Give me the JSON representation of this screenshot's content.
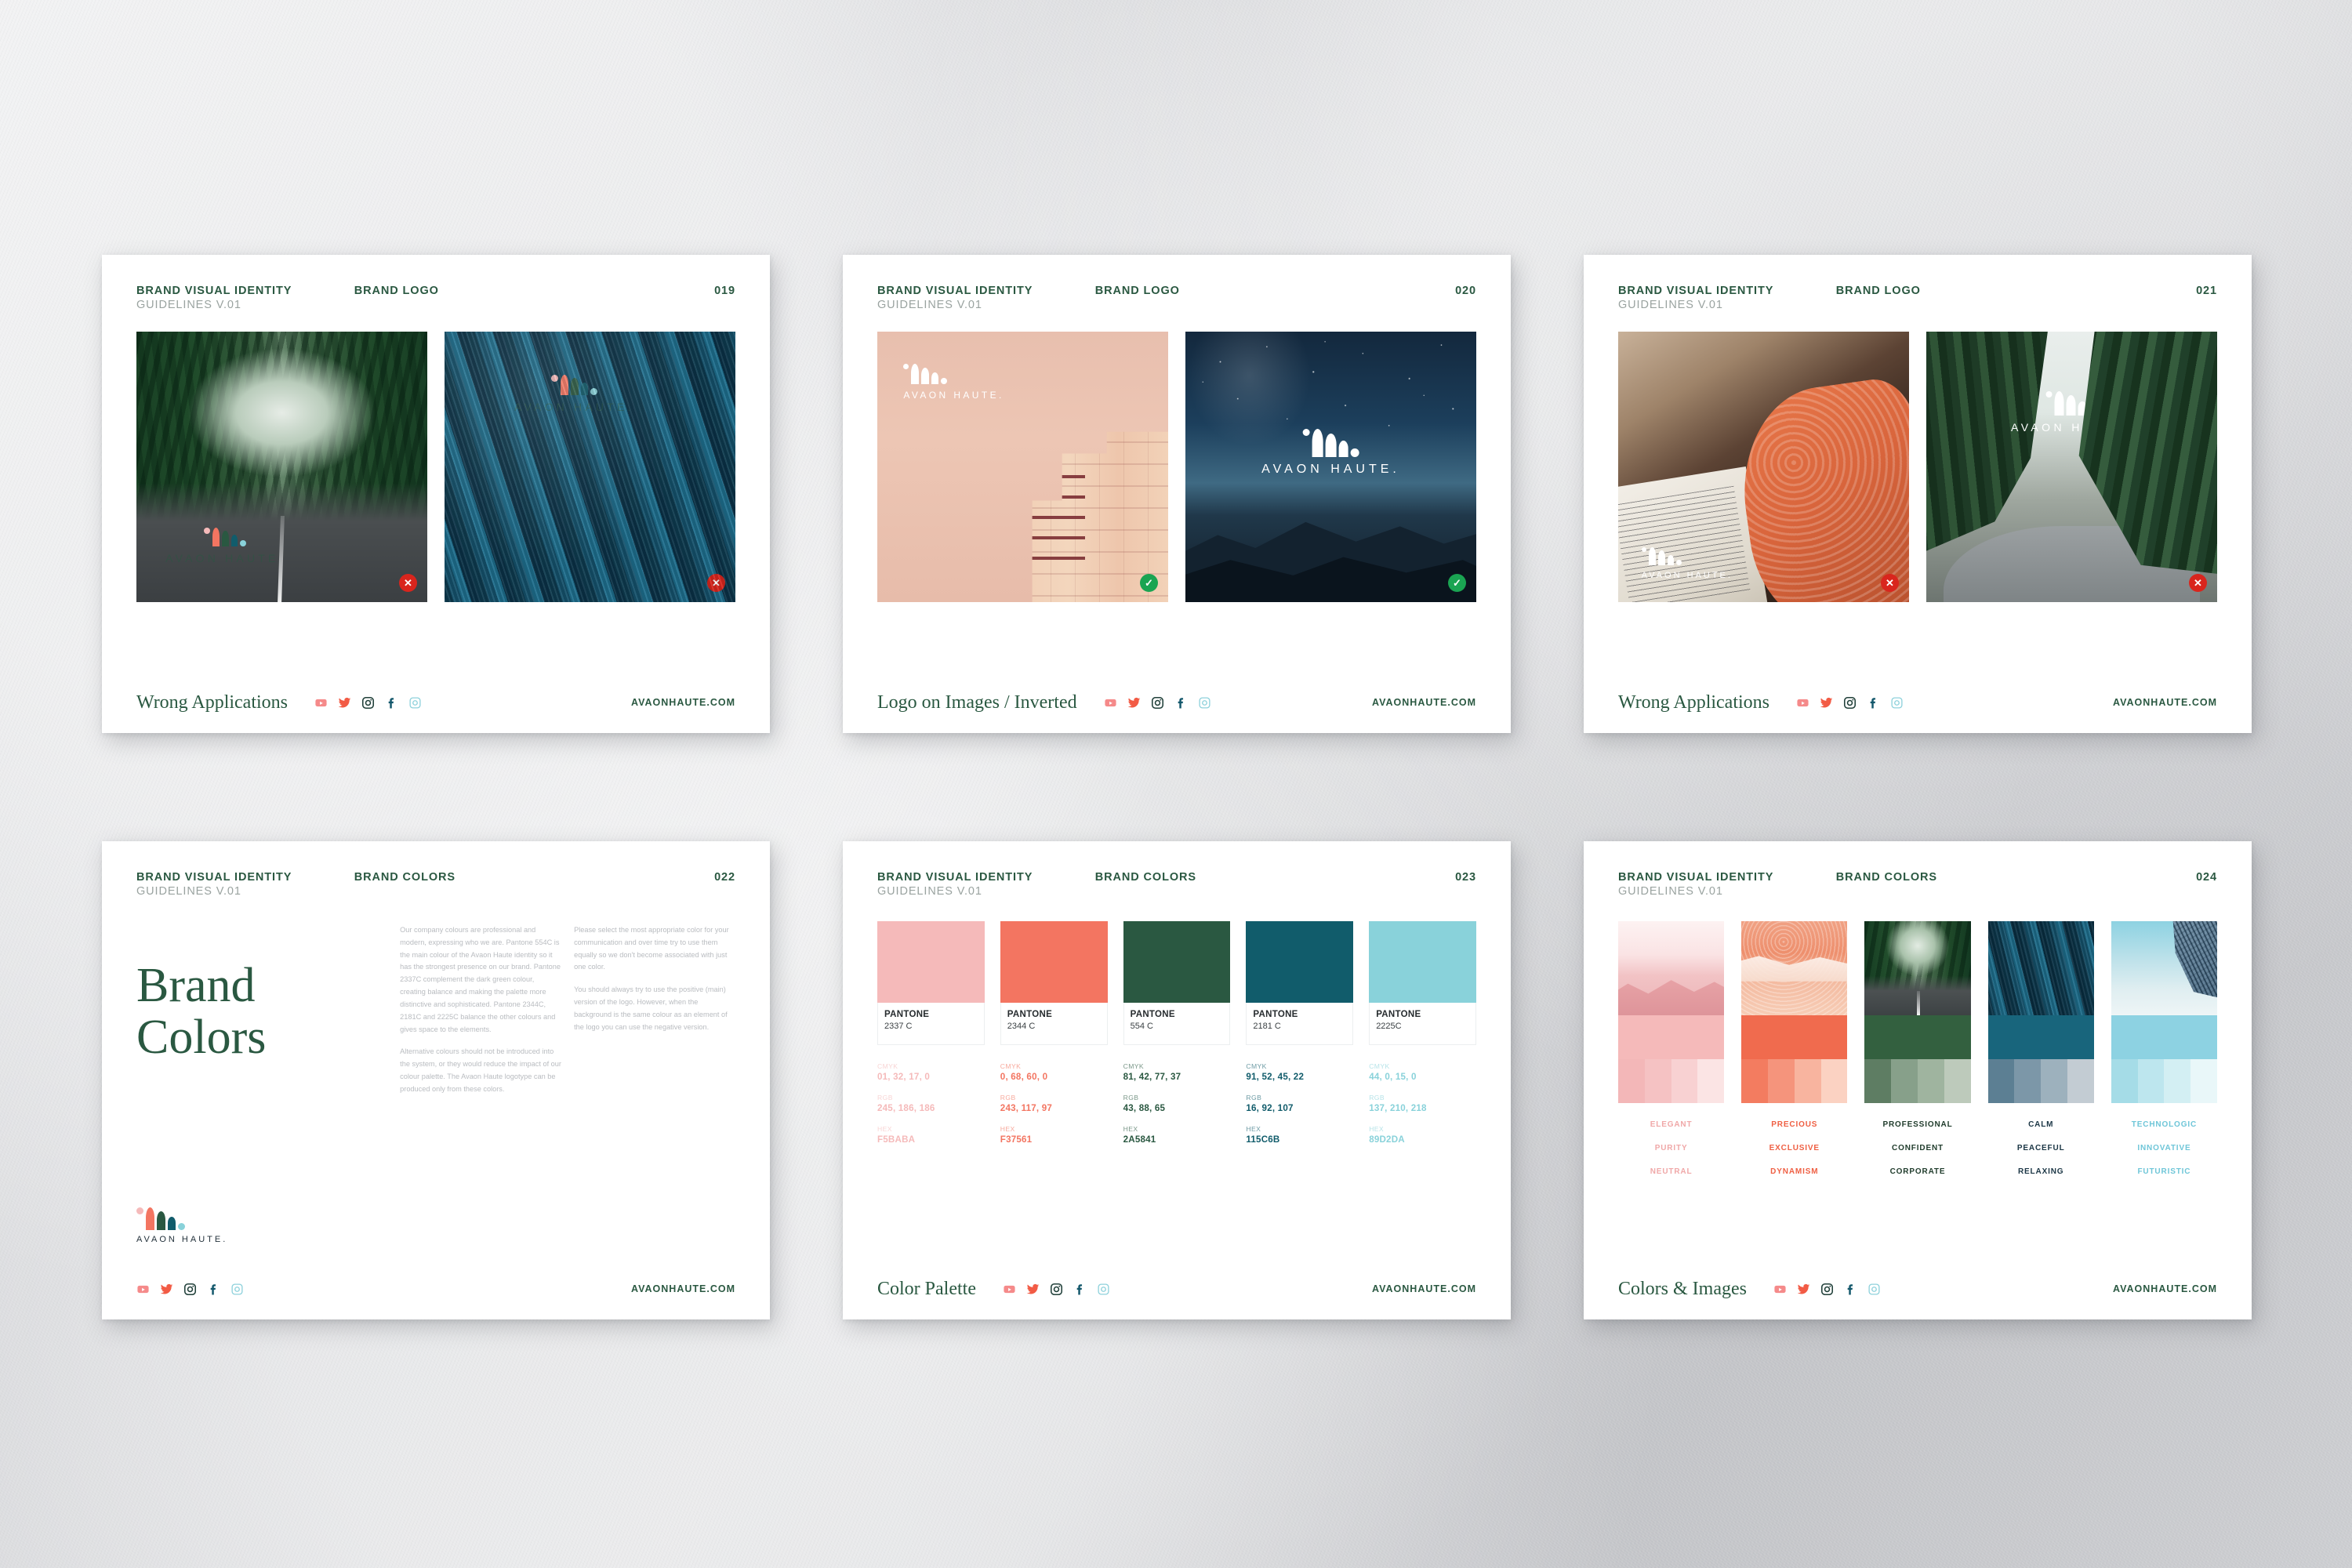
{
  "brand": {
    "name": "AVAON HAUTE.",
    "url": "AVAONHAUTE.COM",
    "colors": {
      "green": "#2A5841",
      "coral": "#F37561",
      "pink": "#F5BABA",
      "teal": "#115C6B",
      "lightblue": "#89D2DA",
      "muted": "#9AA3A0",
      "bad": "#D9251D",
      "good": "#1AA452"
    }
  },
  "socials": [
    {
      "name": "youtube-icon",
      "color": "#F58A8A"
    },
    {
      "name": "twitter-icon",
      "color": "#F25B45"
    },
    {
      "name": "instagram-icon",
      "color": "#21403A"
    },
    {
      "name": "facebook-icon",
      "color": "#14586C"
    },
    {
      "name": "instagram-alt-icon",
      "color": "#8FD2DC"
    }
  ],
  "sheets": [
    {
      "id": "sheet-019",
      "header": {
        "title": "BRAND VISUAL IDENTITY",
        "subtitle": "GUIDELINES V.01",
        "section": "BRAND LOGO",
        "page": "019"
      },
      "footer": {
        "title": "Wrong Applications"
      },
      "images": [
        {
          "name": "forest-road-photo",
          "badge": "bad",
          "badge_glyph": "✕",
          "logo": "color-dim"
        },
        {
          "name": "blue-sand-dunes-photo",
          "badge": "bad",
          "badge_glyph": "✕",
          "logo": "color-dim"
        }
      ]
    },
    {
      "id": "sheet-020",
      "header": {
        "title": "BRAND VISUAL IDENTITY",
        "subtitle": "GUIDELINES V.01",
        "section": "BRAND LOGO",
        "page": "020"
      },
      "footer": {
        "title": "Logo on Images",
        "title2": "Inverted",
        "separator": "/"
      },
      "images": [
        {
          "name": "pink-building-photo",
          "badge": "good",
          "badge_glyph": "✓",
          "logo": "white"
        },
        {
          "name": "night-sky-mountains-photo",
          "badge": "good",
          "badge_glyph": "✓",
          "logo": "white"
        }
      ]
    },
    {
      "id": "sheet-021",
      "header": {
        "title": "BRAND VISUAL IDENTITY",
        "subtitle": "GUIDELINES V.01",
        "section": "BRAND LOGO",
        "page": "021"
      },
      "footer": {
        "title": "Wrong Applications"
      },
      "images": [
        {
          "name": "woman-writing-photo",
          "badge": "bad",
          "badge_glyph": "✕",
          "logo": "white"
        },
        {
          "name": "pine-forest-road-photo",
          "badge": "bad",
          "badge_glyph": "✕",
          "logo": "white"
        }
      ]
    },
    {
      "id": "sheet-022",
      "header": {
        "title": "BRAND VISUAL IDENTITY",
        "subtitle": "GUIDELINES V.01",
        "section": "BRAND COLORS",
        "page": "022"
      },
      "footer": {
        "title": ""
      },
      "heading_line1": "Brand",
      "heading_line2": "Colors",
      "column_left": [
        "Our company colours are professional and modern, expressing who we are. Pantone 554C is the main colour of the Avaon Haute identity so it has the strongest presence on our brand. Pantone 2337C complement the dark green colour, creating balance and making the palette more distinctive and sophisticated. Pantone 2344C, 2181C and 2225C balance the other colours and gives space to the elements.",
        "Alternative colours should not be introduced into the system, or they would reduce the impact of our colour palette. The Avaon Haute logotype can be produced only from these colors."
      ],
      "column_right": [
        "Please select the most appropriate color for your communication and over time try to use them equally so we don't become associated with just one color.",
        "You should always try to use the positive (main) version of the logo. However, when the background is the same colour as an element of the logo you can use the negative version."
      ]
    },
    {
      "id": "sheet-023",
      "header": {
        "title": "BRAND VISUAL IDENTITY",
        "subtitle": "GUIDELINES V.01",
        "section": "BRAND COLORS",
        "page": "023"
      },
      "footer": {
        "title": "Color Palette"
      },
      "spec_keys": {
        "cmyk": "CMYK",
        "rgb": "RGB",
        "hex": "HEX"
      },
      "pantone_label": "PANTONE",
      "swatches": [
        {
          "pantone": "2337 C",
          "cmyk": "01, 32, 17, 0",
          "rgb": "245, 186, 186",
          "hex": "F5BABA",
          "color": "#F5BABA"
        },
        {
          "pantone": "2344 C",
          "cmyk": "0, 68, 60, 0",
          "rgb": "243, 117, 97",
          "hex": "F37561",
          "color": "#F37561"
        },
        {
          "pantone": "554 C",
          "cmyk": "81, 42, 77, 37",
          "rgb": "43, 88, 65",
          "hex": "2A5841",
          "color": "#2A5841"
        },
        {
          "pantone": "2181 C",
          "cmyk": "91, 52, 45, 22",
          "rgb": "16, 92, 107",
          "hex": "115C6B",
          "color": "#115C6B"
        },
        {
          "pantone": "2225C",
          "cmyk": "44, 0, 15, 0",
          "rgb": "137, 210, 218",
          "hex": "89D2DA",
          "color": "#89D2DA"
        }
      ]
    },
    {
      "id": "sheet-024",
      "header": {
        "title": "BRAND VISUAL IDENTITY",
        "subtitle": "GUIDELINES V.01",
        "section": "BRAND COLORS",
        "page": "024"
      },
      "footer": {
        "title": "Colors & Images"
      },
      "columns": [
        {
          "photo": "pink-mountains-photo",
          "solid": "#F5BABA",
          "tints": [
            "#F3B7B8",
            "#F5C2C3",
            "#F8D1D2",
            "#FBE4E4"
          ],
          "words": [
            "ELEGANT",
            "PURITY",
            "NEUTRAL"
          ],
          "word_color": "#F0A8A8"
        },
        {
          "photo": "coral-shoreline-photo",
          "solid": "#F06B4E",
          "tints": [
            "#F37C60",
            "#F5947C",
            "#F8B49F",
            "#FBD2C2"
          ],
          "words": [
            "PRECIOUS",
            "EXCLUSIVE",
            "DYNAMISM"
          ],
          "word_color": "#EF5F43"
        },
        {
          "photo": "green-forest-road-photo",
          "solid": "#33603F",
          "tints": [
            "#5E7D63",
            "#87A08A",
            "#9FB49F",
            "#BDCABB"
          ],
          "words": [
            "PROFESSIONAL",
            "CONFIDENT",
            "CORPORATE"
          ],
          "word_color": "#1F3B2B"
        },
        {
          "photo": "blue-dunes-photo",
          "solid": "#18657C",
          "tints": [
            "#5C7F93",
            "#7C97A8",
            "#9DB1BD",
            "#C3CCD3"
          ],
          "words": [
            "CALM",
            "PEACEFUL",
            "RELAXING"
          ],
          "word_color": "#1B3645"
        },
        {
          "photo": "tech-facade-photo",
          "solid": "#8DD2E2",
          "tints": [
            "#A5DCE7",
            "#BDE6EE",
            "#D3EFF3",
            "#E9F7F9"
          ],
          "words": [
            "TECHNOLOGIC",
            "INNOVATIVE",
            "FUTURISTIC"
          ],
          "word_color": "#6FC6D8"
        }
      ]
    }
  ]
}
